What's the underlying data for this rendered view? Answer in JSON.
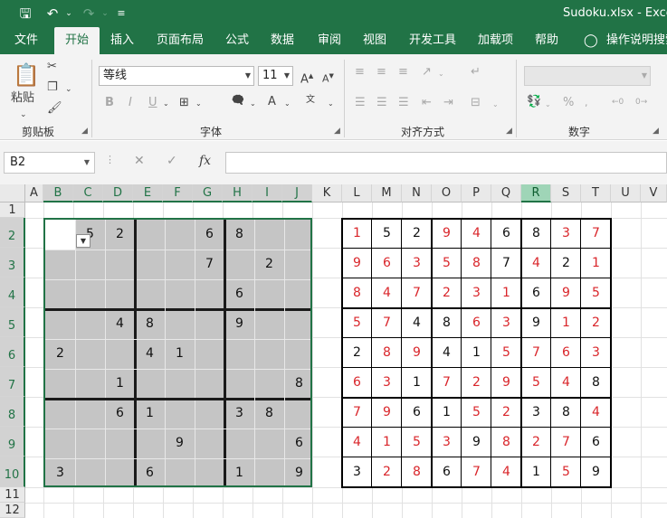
{
  "window": {
    "title": "Sudoku.xlsx  -  Exce"
  },
  "tabs": [
    {
      "label": "文件"
    },
    {
      "label": "开始"
    },
    {
      "label": "插入"
    },
    {
      "label": "页面布局"
    },
    {
      "label": "公式"
    },
    {
      "label": "数据"
    },
    {
      "label": "审阅"
    },
    {
      "label": "视图"
    },
    {
      "label": "开发工具"
    },
    {
      "label": "加载项"
    },
    {
      "label": "帮助"
    },
    {
      "label": "操作说明搜索"
    }
  ],
  "ribbon": {
    "clipboard": {
      "label": "剪贴板",
      "paste_label": "粘贴"
    },
    "font": {
      "label": "字体",
      "name": "等线",
      "size": "11",
      "bold": "B",
      "italic": "I",
      "underline": "U"
    },
    "alignment": {
      "label": "对齐方式"
    },
    "number": {
      "label": "数字",
      "percent": "%"
    }
  },
  "formula_bar": {
    "name_box": "B2",
    "formula": "",
    "fx": "fx"
  },
  "columns": [
    "A",
    "B",
    "C",
    "D",
    "E",
    "F",
    "G",
    "H",
    "I",
    "J",
    "K",
    "L",
    "M",
    "N",
    "O",
    "P",
    "Q",
    "R",
    "S",
    "T",
    "U",
    "V"
  ],
  "rows": [
    "1",
    "2",
    "3",
    "4",
    "5",
    "6",
    "7",
    "8",
    "9",
    "10",
    "11",
    "12"
  ],
  "selected_column_cell": "B",
  "highlighted_column": "R",
  "selected_row": "2",
  "puzzle": [
    [
      "",
      "5",
      "2",
      "",
      "",
      "6",
      "8",
      "",
      ""
    ],
    [
      "",
      "",
      "",
      "",
      "",
      "7",
      "",
      "2",
      ""
    ],
    [
      "",
      "",
      "",
      "",
      "",
      "",
      "6",
      "",
      ""
    ],
    [
      "",
      "",
      "4",
      "8",
      "",
      "",
      "9",
      "",
      ""
    ],
    [
      "2",
      "",
      "",
      "4",
      "1",
      "",
      "",
      "",
      ""
    ],
    [
      "",
      "",
      "1",
      "",
      "",
      "",
      "",
      "",
      "8"
    ],
    [
      "",
      "",
      "6",
      "1",
      "",
      "",
      "3",
      "8",
      ""
    ],
    [
      "",
      "",
      "",
      "",
      "9",
      "",
      "",
      "",
      "6"
    ],
    [
      "3",
      "",
      "",
      "6",
      "",
      "",
      "1",
      "",
      "9"
    ]
  ],
  "solution": [
    [
      "1",
      "5",
      "2",
      "9",
      "4",
      "6",
      "8",
      "3",
      "7"
    ],
    [
      "9",
      "6",
      "3",
      "5",
      "8",
      "7",
      "4",
      "2",
      "1"
    ],
    [
      "8",
      "4",
      "7",
      "2",
      "3",
      "1",
      "6",
      "9",
      "5"
    ],
    [
      "5",
      "7",
      "4",
      "8",
      "6",
      "3",
      "9",
      "1",
      "2"
    ],
    [
      "2",
      "8",
      "9",
      "4",
      "1",
      "5",
      "7",
      "6",
      "3"
    ],
    [
      "6",
      "3",
      "1",
      "7",
      "2",
      "9",
      "5",
      "4",
      "8"
    ],
    [
      "7",
      "9",
      "6",
      "1",
      "5",
      "2",
      "3",
      "8",
      "4"
    ],
    [
      "4",
      "1",
      "5",
      "3",
      "9",
      "8",
      "2",
      "7",
      "6"
    ],
    [
      "3",
      "2",
      "8",
      "6",
      "7",
      "4",
      "1",
      "5",
      "9"
    ]
  ],
  "solution_red_mask": [
    [
      1,
      0,
      0,
      1,
      1,
      0,
      0,
      1,
      1
    ],
    [
      1,
      1,
      1,
      1,
      1,
      0,
      1,
      0,
      1
    ],
    [
      1,
      1,
      1,
      1,
      1,
      1,
      0,
      1,
      1
    ],
    [
      1,
      1,
      0,
      0,
      1,
      1,
      0,
      1,
      1
    ],
    [
      0,
      1,
      1,
      0,
      0,
      1,
      1,
      1,
      1
    ],
    [
      1,
      1,
      0,
      1,
      1,
      1,
      1,
      1,
      0
    ],
    [
      1,
      1,
      0,
      0,
      1,
      1,
      0,
      0,
      1
    ],
    [
      1,
      1,
      1,
      1,
      0,
      1,
      1,
      1,
      0
    ],
    [
      0,
      1,
      1,
      0,
      1,
      1,
      0,
      1,
      0
    ]
  ],
  "colors": {
    "excel_green": "#217346",
    "given_cell_bg": "#c5c5c5",
    "solution_red": "#d9262b",
    "solution_black": "#111111"
  }
}
